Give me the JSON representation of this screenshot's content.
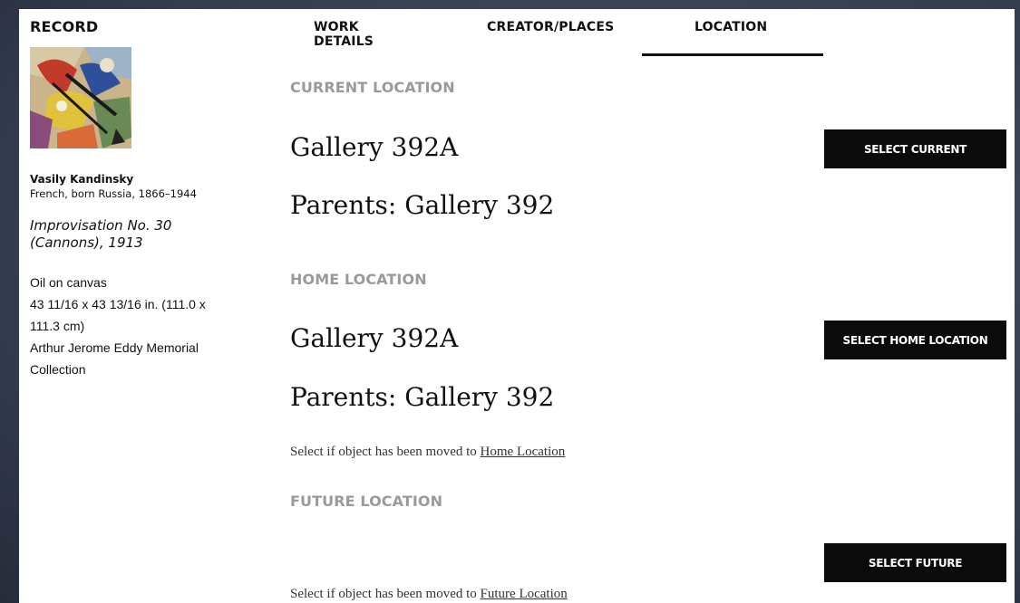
{
  "sidebar": {
    "title": "RECORD",
    "artist_name": "Vasily Kandinsky",
    "artist_bio": "French, born Russia, 1866–1944",
    "work_title_line1": "Improvisation No. 30",
    "work_title_line2": "(Cannons), 1913",
    "medium": "Oil on canvas",
    "dimensions_line1": "43 11/16 x 43 13/16 in. (111.0 x",
    "dimensions_line2": "111.3 cm)",
    "credit_line1": "Arthur Jerome Eddy Memorial",
    "credit_line2": "Collection"
  },
  "tabs": [
    {
      "label": "WORK DETAILS"
    },
    {
      "label": "CREATOR/PLACES"
    },
    {
      "label": "LOCATION",
      "active": true
    }
  ],
  "current": {
    "label": "CURRENT LOCATION",
    "gallery": "Gallery 392A",
    "parents": "Parents: Gallery 392",
    "button": "SELECT CURRENT"
  },
  "home": {
    "label": "HOME LOCATION",
    "gallery": "Gallery 392A",
    "parents": "Parents: Gallery 392",
    "button": "SELECT HOME LOCATION",
    "note_prefix": "Select if object has been moved to ",
    "note_link": "Home Location"
  },
  "future": {
    "label": "FUTURE LOCATION",
    "button": "SELECT FUTURE",
    "note_prefix": "Select if object has been moved to ",
    "note_link": "Future Location"
  }
}
